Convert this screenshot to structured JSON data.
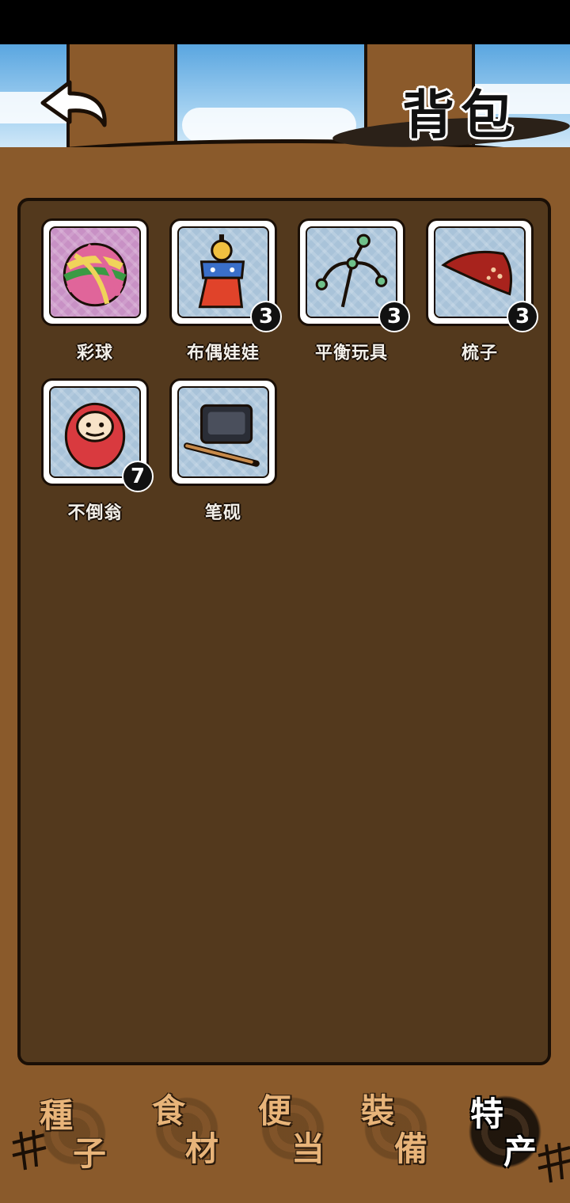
{
  "header": {
    "title": "背包",
    "back_icon": "back-arrow-icon"
  },
  "inventory": {
    "items": [
      {
        "name": "彩球",
        "count": "",
        "icon": "yarn-ball-icon",
        "bg": "#c891c5"
      },
      {
        "name": "布偶娃娃",
        "count": "3",
        "icon": "cloth-doll-icon",
        "bg": "#a9c3d9"
      },
      {
        "name": "平衡玩具",
        "count": "3",
        "icon": "balance-toy-icon",
        "bg": "#a9c3d9"
      },
      {
        "name": "梳子",
        "count": "3",
        "icon": "comb-icon",
        "bg": "#a9c3d9"
      },
      {
        "name": "不倒翁",
        "count": "7",
        "icon": "daruma-icon",
        "bg": "#a9c3d9"
      },
      {
        "name": "笔砚",
        "count": "",
        "icon": "inkstone-brush-icon",
        "bg": "#a9c3d9"
      }
    ]
  },
  "tabs": [
    {
      "label_1": "種",
      "label_2": "子",
      "active": false
    },
    {
      "label_1": "食",
      "label_2": "材",
      "active": false
    },
    {
      "label_1": "便",
      "label_2": "当",
      "active": false
    },
    {
      "label_1": "裝",
      "label_2": "備",
      "active": false
    },
    {
      "label_1": "特",
      "label_2": "产",
      "active": true
    }
  ],
  "colors": {
    "board": "#8a5a2b",
    "panel": "#53391d",
    "tab_text": "#e8b479",
    "active_tab_text": "#ffffff"
  }
}
